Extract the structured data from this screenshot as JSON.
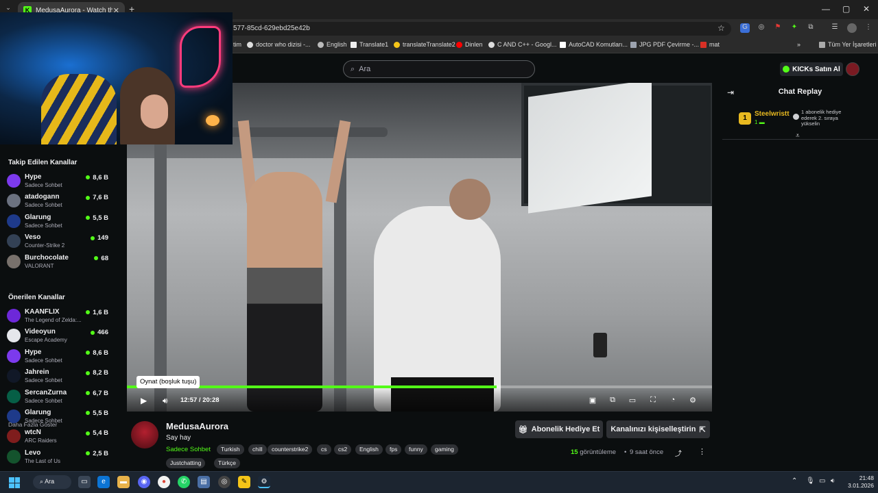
{
  "browser": {
    "tab_title": "MedusaAurora - Watch the VOD",
    "url_fragment": "577-85cd-629ebd25e42b",
    "bookmarks": [
      "tim",
      "doctor who dizisi -...",
      "English",
      "Translate1",
      "translateTranslate2",
      "Dinlen",
      "C AND C++ - Googl...",
      "AutoCAD Komutları...",
      "JPG PDF Çevirme -...",
      "mat",
      "Tüm Yer İşaretleri"
    ]
  },
  "header": {
    "search_placeholder": "Ara",
    "kicks_button": "KICKs Satın Al"
  },
  "sidebar": {
    "followed_title": "Takip Edilen Kanallar",
    "followed": [
      {
        "name": "Hype",
        "category": "Sadece Sohbet",
        "viewers": "8,6 B",
        "color": "#7c3aed"
      },
      {
        "name": "atadogann",
        "category": "Sadece Sohbet",
        "viewers": "7,6 B",
        "color": "#6b7280"
      },
      {
        "name": "Glarung",
        "category": "Sadece Sohbet",
        "viewers": "5,5 B",
        "color": "#1e3a8a"
      },
      {
        "name": "Veso",
        "category": "Counter-Strike 2",
        "viewers": "149",
        "color": "#334155"
      },
      {
        "name": "Burchocolate",
        "category": "VALORANT",
        "viewers": "68",
        "color": "#78716c"
      }
    ],
    "show_more": "Daha Fazla Göster",
    "recommended_title": "Önerilen Kanallar",
    "recommended": [
      {
        "name": "KAANFLIX",
        "category": "The Legend of Zelda:...",
        "viewers": "1,6 B",
        "color": "#6d28d9"
      },
      {
        "name": "Videoyun",
        "category": "Escape Academy",
        "viewers": "466",
        "color": "#e5e7eb"
      },
      {
        "name": "Hype",
        "category": "Sadece Sohbet",
        "viewers": "8,6 B",
        "color": "#7c3aed"
      },
      {
        "name": "Jahrein",
        "category": "Sadece Sohbet",
        "viewers": "8,2 B",
        "color": "#111827"
      },
      {
        "name": "SercanZurna",
        "category": "Sadece Sohbet",
        "viewers": "6,7 B",
        "color": "#065f46"
      },
      {
        "name": "Glarung",
        "category": "Sadece Sohbet",
        "viewers": "5,5 B",
        "color": "#1e3a8a"
      },
      {
        "name": "wtcN",
        "category": "ARC Raiders",
        "viewers": "5,4 B",
        "color": "#7f1d1d"
      },
      {
        "name": "Levo",
        "category": "The Last of Us",
        "viewers": "2,5 B",
        "color": "#14532d"
      }
    ]
  },
  "player": {
    "tooltip": "Oynat (boşluk tuşu)",
    "time": "12:57 / 20:28",
    "progress": 0.632
  },
  "chat": {
    "title": "Chat Replay",
    "gift_user": "Steelwristt",
    "gift_badge": "1",
    "gift_sub": "1",
    "gift_text": "1 abonelik hediye ederek 2. sıraya yükselin"
  },
  "channel": {
    "name": "MedusaAurora",
    "title": "Say hay",
    "category": "Sadece Sohbet",
    "tags": [
      "Turkish",
      "chill",
      "counterstrike2",
      "cs",
      "cs2",
      "English",
      "fps",
      "funny",
      "gaming",
      "Justchatting",
      "Türkçe"
    ],
    "gift_sub_button": "Abonelik Hediye Et",
    "customize_button": "Kanalınızı kişiselleştirin",
    "views_count": "15",
    "views_label": "görüntüleme",
    "ago": "9 saat önce"
  },
  "taskbar": {
    "search": "Ara",
    "time": "21:48",
    "date": "3.01.2026"
  },
  "colors": {
    "accent": "#53fc18",
    "background": "#0b0e0f",
    "gold": "#e8b920"
  }
}
